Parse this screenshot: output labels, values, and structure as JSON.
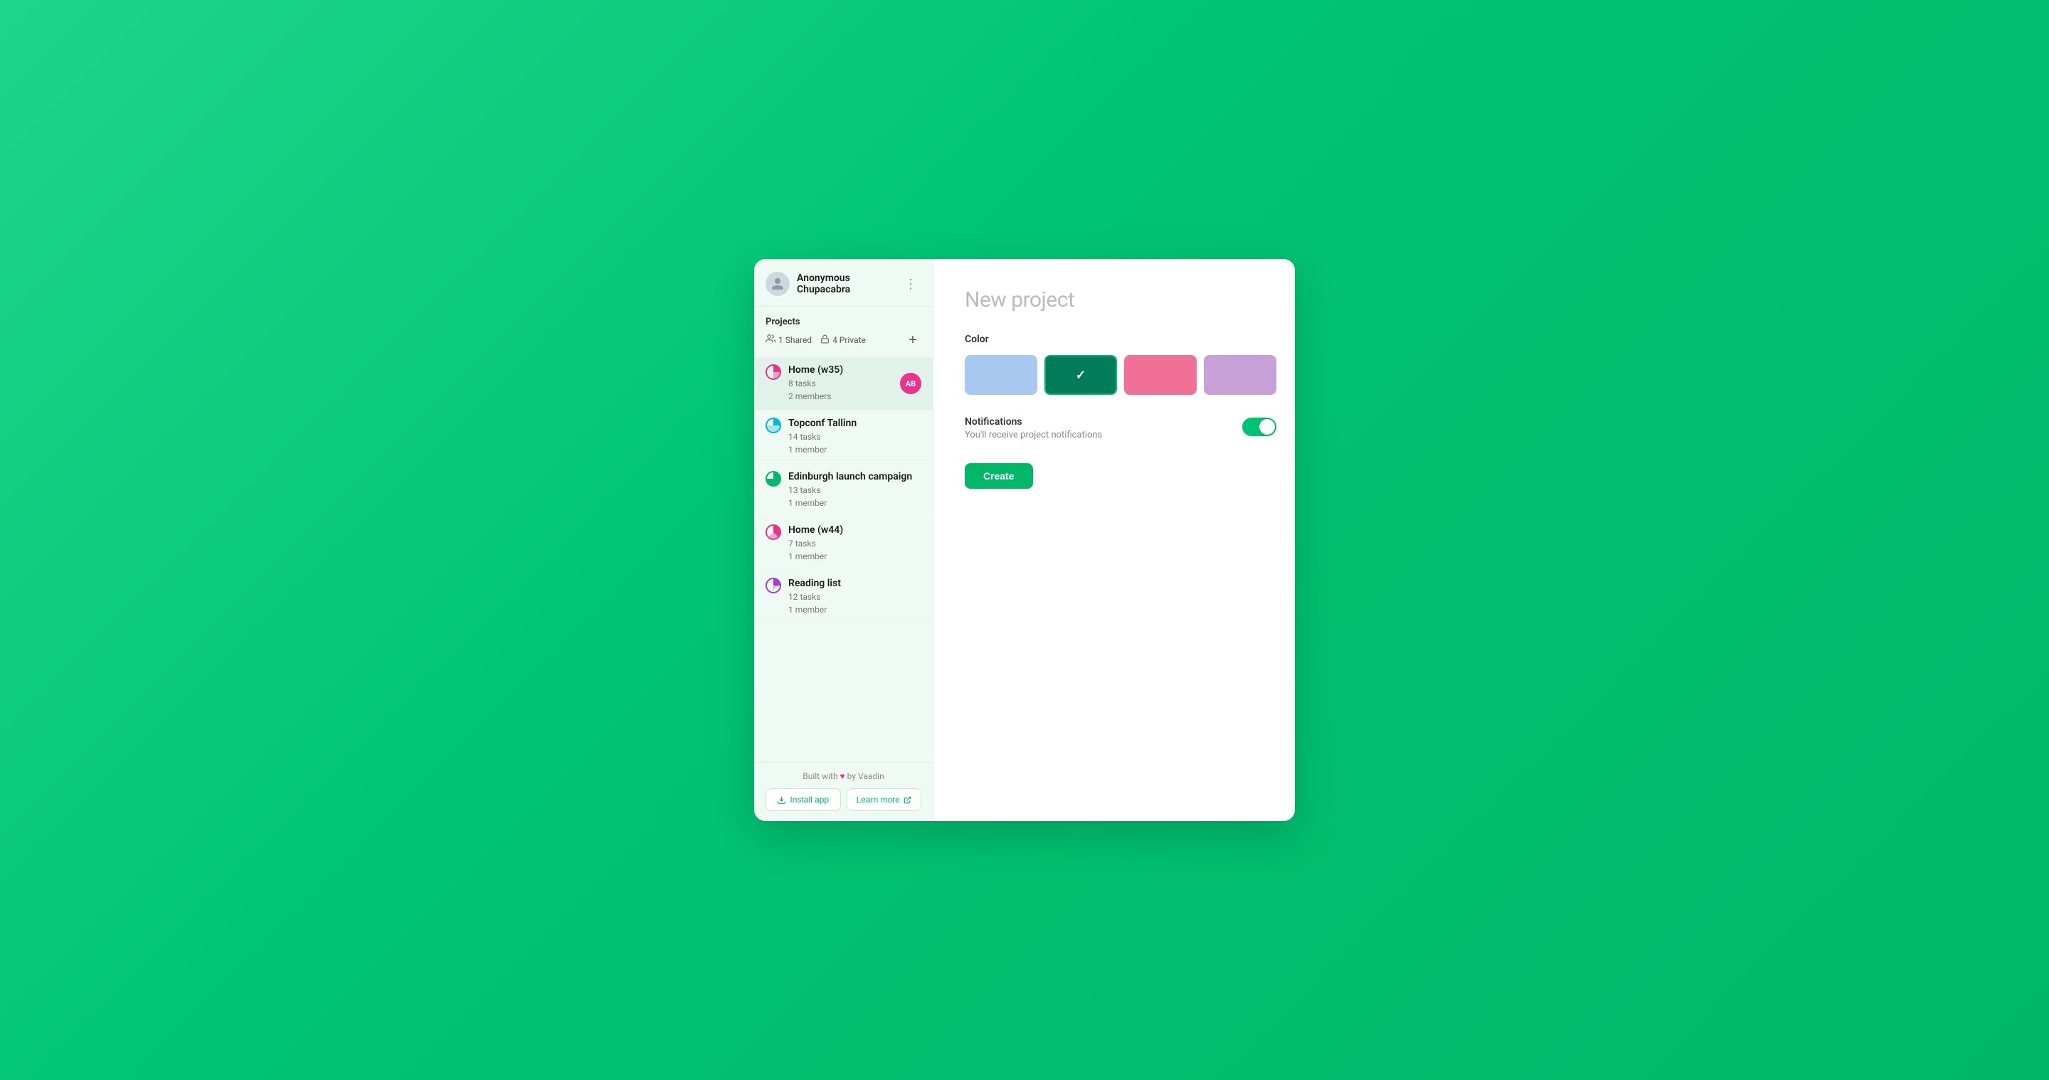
{
  "app": {
    "title": "New project"
  },
  "sidebar": {
    "user": {
      "name": "Anonymous Chupacabra"
    },
    "projects": {
      "label": "Projects",
      "shared_count": "1 Shared",
      "private_count": "4 Private"
    },
    "items": [
      {
        "name": "Home (w35)",
        "tasks": "8 tasks",
        "members": "2 members",
        "color": "#e8358a",
        "has_avatar": true,
        "avatar_initials": "AB",
        "active": true
      },
      {
        "name": "Topconf Tallinn",
        "tasks": "14 tasks",
        "members": "1 member",
        "color": "#00b8d4",
        "has_avatar": false,
        "active": false
      },
      {
        "name": "Edinburgh launch campaign",
        "tasks": "13 tasks",
        "members": "1 member",
        "color": "#00b868",
        "has_avatar": false,
        "active": false
      },
      {
        "name": "Home (w44)",
        "tasks": "7 tasks",
        "members": "1 member",
        "color": "#e8358a",
        "has_avatar": false,
        "active": false
      },
      {
        "name": "Reading list",
        "tasks": "12 tasks",
        "members": "1 member",
        "color": "#a040c8",
        "has_avatar": false,
        "active": false
      }
    ],
    "footer": {
      "built_text": "Built with",
      "by_vaadin": " by Vaadin",
      "install_label": "Install app",
      "learn_more_label": "Learn more"
    }
  },
  "main": {
    "title": "New project",
    "color_label": "Color",
    "colors": [
      {
        "value": "#a8c8f0",
        "selected": false
      },
      {
        "value": "#007c5a",
        "selected": true
      },
      {
        "value": "#f07098",
        "selected": false
      },
      {
        "value": "#c8a0d8",
        "selected": false
      }
    ],
    "notifications": {
      "label": "Notifications",
      "description": "You'll receive project notifications",
      "enabled": true
    },
    "create_label": "Create"
  }
}
